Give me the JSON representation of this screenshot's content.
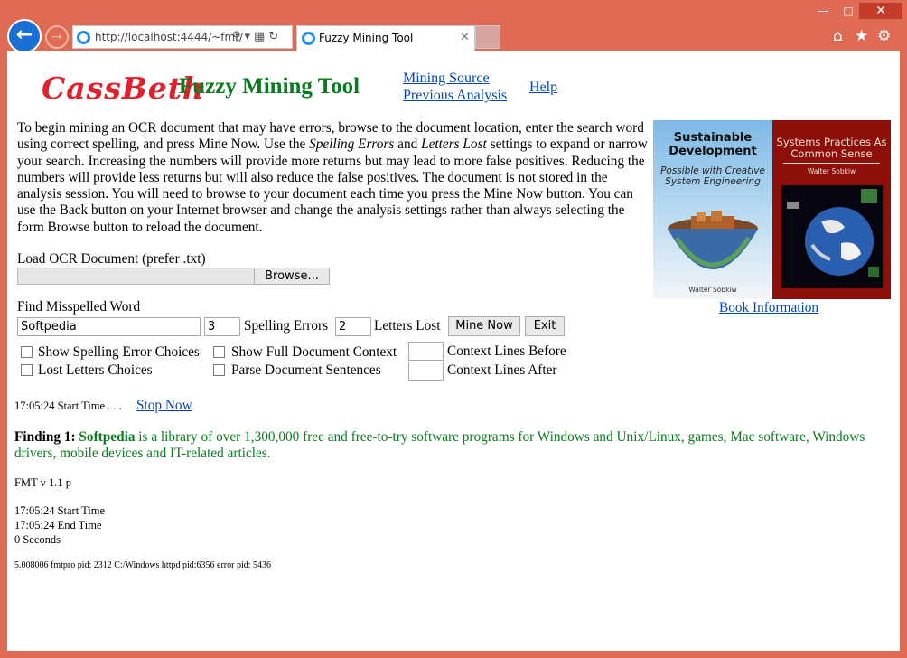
{
  "browser": {
    "address": "http://localhost:4444/~fmt/",
    "tab_title": "Fuzzy Mining Tool"
  },
  "header": {
    "logo": "CassBeth",
    "title": "Fuzzy Mining Tool",
    "links": {
      "mining_source": "Mining Source",
      "previous_analysis": "Previous Analysis",
      "help": "Help"
    }
  },
  "intro": {
    "p1": "To begin mining an OCR document that may have errors, browse to the document location, enter the search word using correct spelling, and press Mine Now. Use the ",
    "em1": "Spelling Errors",
    "and": " and ",
    "em2": "Letters Lost",
    "p2": " settings to expand or narrow your search. Increasing the numbers will provide more returns but may lead to more false positives. Reducing the numbers will provide less returns but will also reduce the false positives. The document is not stored in the analysis session. You will need to browse to your document each time you press the Mine Now button. You can use the Back button on your Internet browser and change the analysis settings rather than always selecting the form Browse button to reload the document."
  },
  "form": {
    "load_label": "Load OCR Document (prefer .txt)",
    "browse_label": "Browse...",
    "find_label": "Find Misspelled Word",
    "search_value": "Softpedia",
    "spelling_errors_value": "3",
    "spelling_errors_label": "Spelling Errors",
    "letters_lost_value": "2",
    "letters_lost_label": "Letters Lost",
    "mine_now_label": "Mine Now",
    "exit_label": "Exit",
    "options": {
      "show_spelling_error_choices": "Show Spelling Error Choices",
      "lost_letters_choices": "Lost Letters Choices",
      "show_full_document_context": "Show Full Document Context",
      "parse_document_sentences": "Parse Document Sentences",
      "context_lines_before": "Context Lines Before",
      "context_lines_after": "Context Lines After"
    }
  },
  "books": {
    "book1": {
      "title": "Sustainable Development",
      "subtitle": "Possible with Creative System Engineering",
      "author": "Walter Sobkiw"
    },
    "book2": {
      "title": "Systems Practices As Common Sense",
      "author": "Walter Sobkiw"
    },
    "info_link": "Book Information"
  },
  "status": {
    "start_time": "17:05:24 Start Time . . .",
    "stop_now": "Stop Now"
  },
  "finding": {
    "label": "Finding 1:",
    "highlight": "Softpedia",
    "text": " is a library of over 1,300,000 free and free-to-try software programs for Windows and Unix/Linux, games, Mac software, Windows drivers, mobile devices and IT-related articles."
  },
  "footer": {
    "version": "FMT v 1.1 p",
    "start": "17:05:24 Start Time",
    "end": "17:05:24 End Time",
    "duration": "0 Seconds",
    "process": "5.008006 fmtpro pid: 2312 C:/Windows httpd pid:6356 error pid: 5436"
  },
  "colors": {
    "chrome": "#e06b55",
    "title_green": "#0a7a1e",
    "logo_red": "#e0202a",
    "link_blue": "#0645ad"
  }
}
